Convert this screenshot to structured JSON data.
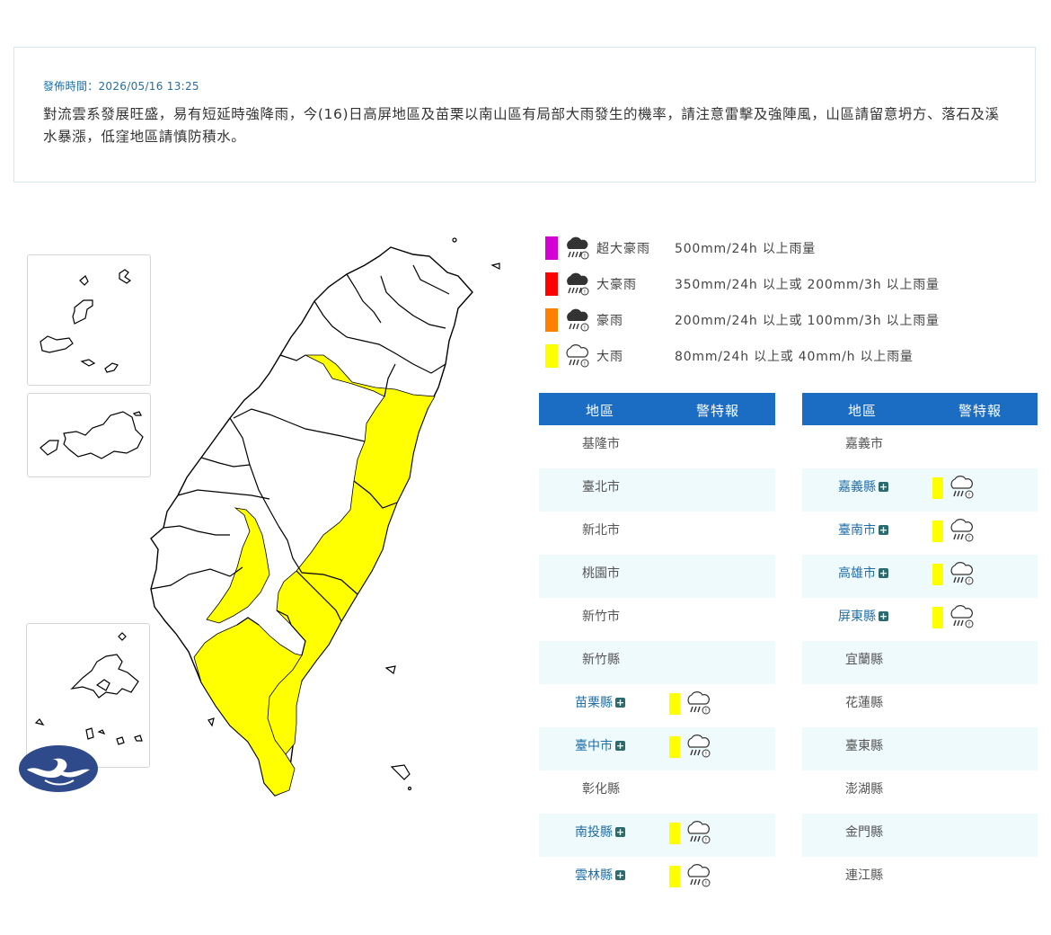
{
  "notice": {
    "time": "發佈時間：2026/05/16 13:25",
    "text": "對流雲系發展旺盛，易有短延時強降雨，今(16)日高屏地區及苗栗以南山區有局部大雨發生的機率，請注意雷擊及強陣風，山區請留意坍方、落石及溪水暴漲，低窪地區請慎防積水。"
  },
  "legend": [
    {
      "name": "超大豪雨",
      "desc": "500mm/24h 以上雨量",
      "color": "#d400d4",
      "icon": "extreme-torrential-rain-icon"
    },
    {
      "name": "大豪雨",
      "desc": "350mm/24h 以上或 200mm/3h 以上雨量",
      "color": "#ff0000",
      "icon": "torrential-rain-icon"
    },
    {
      "name": "豪雨",
      "desc": "200mm/24h 以上或 100mm/3h 以上雨量",
      "color": "#ff7f00",
      "icon": "extremely-heavy-rain-icon"
    },
    {
      "name": "大雨",
      "desc": "80mm/24h 以上或 40mm/h 以上雨量",
      "color": "#ffff00",
      "icon": "heavy-rain-icon"
    }
  ],
  "table_header": {
    "region": "地區",
    "warning": "警特報"
  },
  "left_table": [
    {
      "name": "基隆市",
      "warn": false
    },
    {
      "name": "臺北市",
      "warn": false
    },
    {
      "name": "新北市",
      "warn": false
    },
    {
      "name": "桃園市",
      "warn": false
    },
    {
      "name": "新竹市",
      "warn": false
    },
    {
      "name": "新竹縣",
      "warn": false
    },
    {
      "name": "苗栗縣",
      "warn": true
    },
    {
      "name": "臺中市",
      "warn": true
    },
    {
      "name": "彰化縣",
      "warn": false
    },
    {
      "name": "南投縣",
      "warn": true
    },
    {
      "name": "雲林縣",
      "warn": true
    }
  ],
  "right_table": [
    {
      "name": "嘉義市",
      "warn": false
    },
    {
      "name": "嘉義縣",
      "warn": true
    },
    {
      "name": "臺南市",
      "warn": true
    },
    {
      "name": "高雄市",
      "warn": true
    },
    {
      "name": "屏東縣",
      "warn": true
    },
    {
      "name": "宜蘭縣",
      "warn": false
    },
    {
      "name": "花蓮縣",
      "warn": false
    },
    {
      "name": "臺東縣",
      "warn": false
    },
    {
      "name": "澎湖縣",
      "warn": false
    },
    {
      "name": "金門縣",
      "warn": false
    },
    {
      "name": "連江縣",
      "warn": false
    }
  ],
  "warning_color": "#ffff00",
  "header_color": "#1a6dc2"
}
